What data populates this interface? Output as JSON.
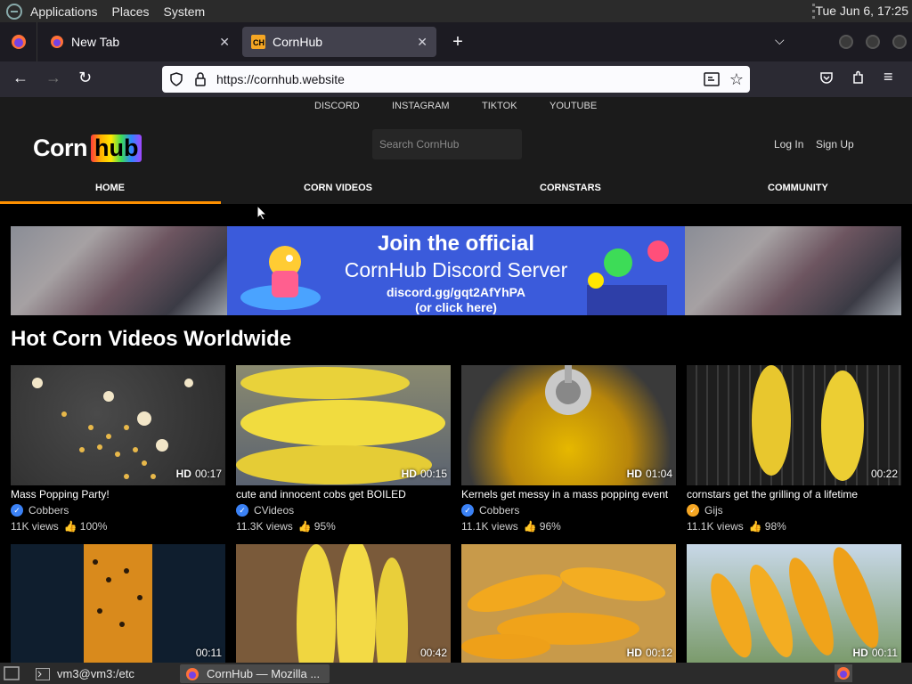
{
  "system_panel": {
    "menus": [
      "Applications",
      "Places",
      "System"
    ],
    "clock": "Tue Jun  6, 17:25"
  },
  "browser": {
    "tabs": [
      {
        "label": "New Tab",
        "active": false
      },
      {
        "label": "CornHub",
        "active": true
      }
    ],
    "url": "https://cornhub.website"
  },
  "site": {
    "socials": [
      "DISCORD",
      "INSTAGRAM",
      "TIKTOK",
      "YOUTUBE"
    ],
    "brand": {
      "corn": "Corn",
      "hub": "hub"
    },
    "search_placeholder": "Search CornHub",
    "auth": {
      "login": "Log In",
      "signup": "Sign Up"
    },
    "nav": [
      "HOME",
      "CORN VIDEOS",
      "CORNSTARS",
      "COMMUNITY"
    ],
    "banner": {
      "line1": "Join the official",
      "line2": "CornHub Discord Server",
      "line3": "discord.gg/gqt2AfYhPA",
      "line4": "(or click here)"
    },
    "section_title": "Hot Corn Videos Worldwide",
    "videos": [
      {
        "title": "Mass Popping Party!",
        "hd": "HD",
        "duration": "00:17",
        "channel": "Cobbers",
        "views": "11K views",
        "rating": "100%",
        "badge_color": "#3b82f6"
      },
      {
        "title": "cute and innocent cobs get BOILED",
        "hd": "HD",
        "duration": "00:15",
        "channel": "CVideos",
        "views": "11.3K views",
        "rating": "95%",
        "badge_color": "#3b82f6"
      },
      {
        "title": "Kernels get messy in a mass popping event",
        "hd": "HD",
        "duration": "01:04",
        "channel": "Cobbers",
        "views": "11.1K views",
        "rating": "96%",
        "badge_color": "#3b82f6"
      },
      {
        "title": "cornstars get the grilling of a lifetime",
        "hd": "",
        "duration": "00:22",
        "channel": "Gijs",
        "views": "11.1K views",
        "rating": "98%",
        "badge_color": "#f5a623"
      },
      {
        "hd": "",
        "duration": "00:11"
      },
      {
        "hd": "",
        "duration": "00:42"
      },
      {
        "hd": "HD",
        "duration": "00:12"
      },
      {
        "hd": "HD",
        "duration": "00:11"
      }
    ]
  },
  "taskbar": {
    "items": [
      "vm3@vm3:/etc",
      "CornHub — Mozilla ..."
    ]
  },
  "colors": {
    "accent": "#ff9000",
    "discord_blue": "#3b5bdb"
  }
}
